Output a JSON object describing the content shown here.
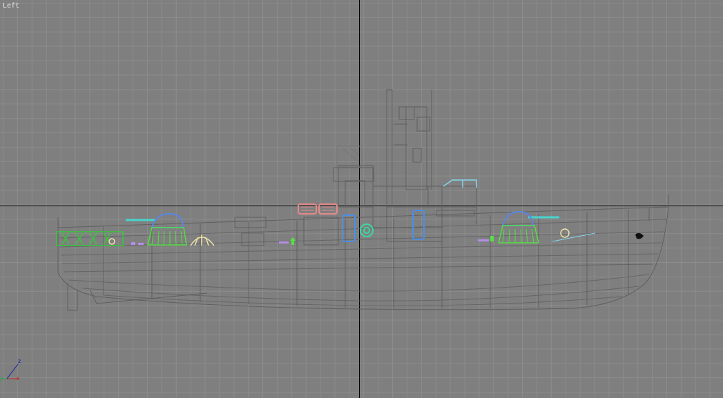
{
  "viewport": {
    "label": "Left",
    "grid_color": "#969696",
    "background_color": "#7f7f7f",
    "axis_color": "#000000"
  },
  "scene": {
    "model": "patrol-boat-wireframe",
    "wire_color": "#5f5f5f",
    "colors": {
      "turret_dome": "#5a86e8",
      "turret_base": "#55e043",
      "barrel": "#45d6cf",
      "liferafts": "#e88a8a",
      "railing": "#35c93a",
      "lifeboat_davit": "#f0e3a8",
      "fittings": "#b48ee8",
      "blue_hatch": "#4a8fe8",
      "green_ring": "#3ad8a0",
      "cyan_rail": "#85d8ee",
      "anchor": "#111111"
    }
  },
  "gizmo": {
    "z_label": "z",
    "y_label": "y",
    "x_label": "x",
    "z_color": "#1020a0",
    "y_color": "#20a040",
    "x_color": "#c02020"
  }
}
